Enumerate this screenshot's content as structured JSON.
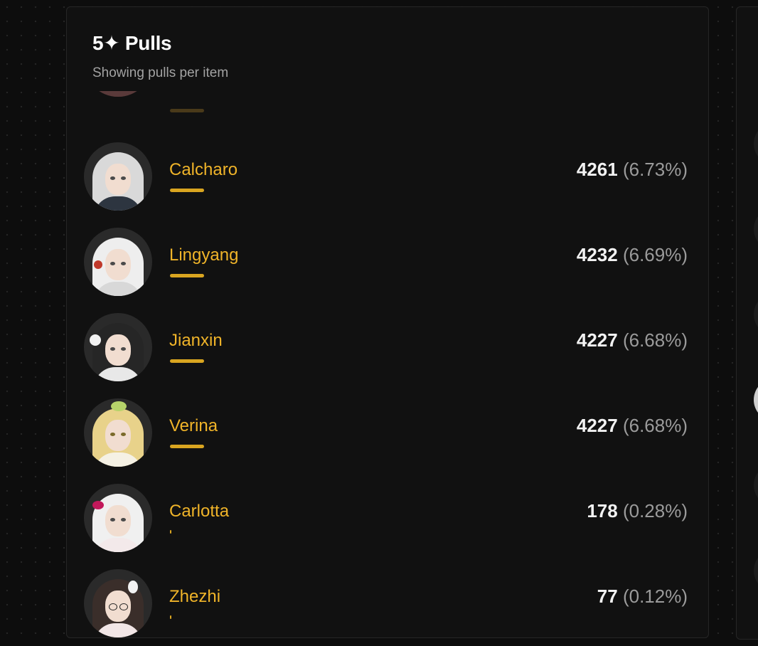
{
  "panel": {
    "title": "5✦ Pulls",
    "subtitle": "Showing pulls per item"
  },
  "items": [
    {
      "name": "Calcharo",
      "count": "4261",
      "percent": "(6.73%)",
      "share": 6.73,
      "hair": "#d9d9d9",
      "outfit": "#2d3540",
      "accent": "#1a1a1a"
    },
    {
      "name": "Lingyang",
      "count": "4232",
      "percent": "(6.69%)",
      "share": 6.69,
      "hair": "#eeeeee",
      "outfit": "#d8d8d8",
      "accent": "#c0392b"
    },
    {
      "name": "Jianxin",
      "count": "4227",
      "percent": "(6.68%)",
      "share": 6.68,
      "hair": "#262626",
      "outfit": "#e8e8e8",
      "accent": "#9fc5a0"
    },
    {
      "name": "Verina",
      "count": "4227",
      "percent": "(6.68%)",
      "share": 6.68,
      "hair": "#e8d28a",
      "outfit": "#f5f1e4",
      "accent": "#b6d36a"
    },
    {
      "name": "Carlotta",
      "count": "178",
      "percent": "(0.28%)",
      "share": 0.28,
      "hair": "#f0f0f0",
      "outfit": "#f3e9ea",
      "accent": "#c2185b"
    },
    {
      "name": "Zhezhi",
      "count": "77",
      "percent": "(0.12%)",
      "share": 0.12,
      "hair": "#3a2e2a",
      "outfit": "#f2e6e6",
      "accent": "#c94a5a"
    }
  ],
  "colors": {
    "accent": "#f0b429",
    "bar": "#d9a520",
    "background": "#0d0d0d",
    "card": "#111111"
  }
}
